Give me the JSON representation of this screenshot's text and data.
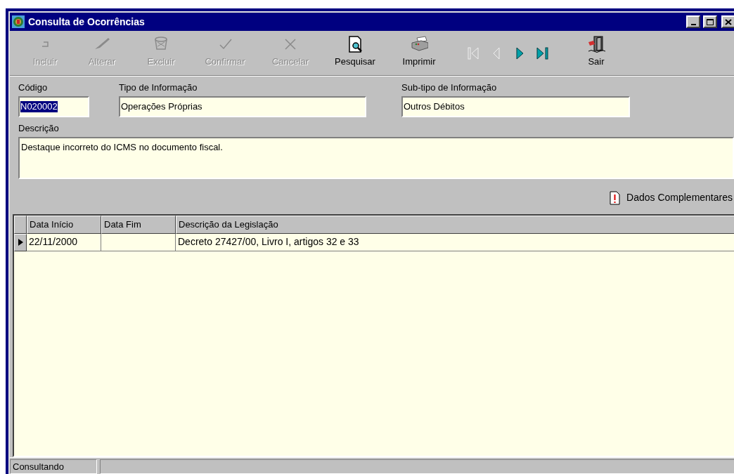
{
  "window": {
    "title": "Consulta de Ocorrências"
  },
  "toolbar": [
    {
      "kind": "button",
      "label": "Incluir",
      "disabled": true
    },
    {
      "kind": "button",
      "label": "Alterar",
      "disabled": true
    },
    {
      "kind": "button",
      "label": "Excluir",
      "disabled": true
    },
    {
      "kind": "button",
      "label": "Confirmar",
      "disabled": true
    },
    {
      "kind": "button",
      "label": "Cancelar",
      "disabled": true
    },
    {
      "kind": "button",
      "label": "Pesquisar",
      "disabled": false
    },
    {
      "kind": "button",
      "label": "Imprimir",
      "disabled": false
    },
    {
      "kind": "nav",
      "disabled": true
    },
    {
      "kind": "nav",
      "disabled": true
    },
    {
      "kind": "nav",
      "disabled": false
    },
    {
      "kind": "nav",
      "disabled": false
    },
    {
      "kind": "button",
      "label": "Sair",
      "disabled": false
    }
  ],
  "fields": [
    {
      "label": "Código",
      "value": "N020002",
      "text_selected": true
    },
    {
      "label": "Tipo de Informação",
      "value": "Operações Próprias",
      "text_selected": false
    },
    {
      "label": "Sub-tipo de Informação",
      "value": "Outros Débitos",
      "text_selected": false
    }
  ],
  "description": {
    "label": "Descrição",
    "value": "Destaque incorreto do ICMS no documento fiscal."
  },
  "complement_link": "Dados Complementares",
  "table": {
    "columns": [
      "Data Início",
      "Data Fim",
      "Descrição da Legislação"
    ],
    "rows": [
      {
        "cells": [
          "22/11/2000",
          "",
          "Decreto 27427/00, Livro I, artigos 32 e 33"
        ],
        "selected": true
      }
    ]
  },
  "status_bar": [
    "Consultando"
  ]
}
